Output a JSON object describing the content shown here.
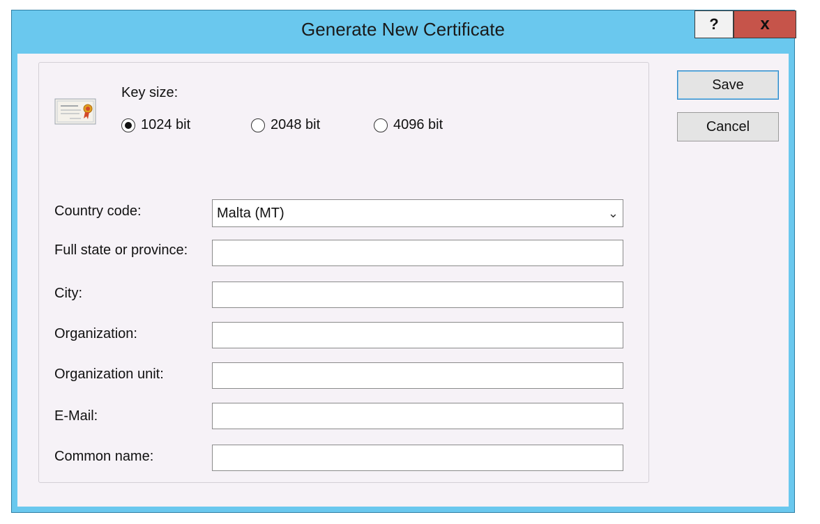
{
  "window": {
    "title": "Generate New Certificate",
    "help_label": "?",
    "close_label": "x"
  },
  "key_size": {
    "label": "Key size:",
    "options": [
      {
        "label": "1024 bit",
        "checked": true
      },
      {
        "label": "2048 bit",
        "checked": false
      },
      {
        "label": "4096 bit",
        "checked": false
      }
    ]
  },
  "form": {
    "country_label": "Country code:",
    "country_value": "Malta (MT)",
    "state_label": "Full state or province:",
    "state_value": "",
    "city_label": "City:",
    "city_value": "",
    "org_label": "Organization:",
    "org_value": "",
    "org_unit_label": "Organization unit:",
    "org_unit_value": "",
    "email_label": "E-Mail:",
    "email_value": "",
    "common_name_label": "Common name:",
    "common_name_value": ""
  },
  "buttons": {
    "save_label": "Save",
    "cancel_label": "Cancel"
  },
  "icons": {
    "certificate": "certificate-icon",
    "dropdown": "chevron-down-icon"
  },
  "colors": {
    "title_bar": "#6ac8ee",
    "close_button": "#c6544a",
    "dialog_background": "#f6f2f7"
  }
}
